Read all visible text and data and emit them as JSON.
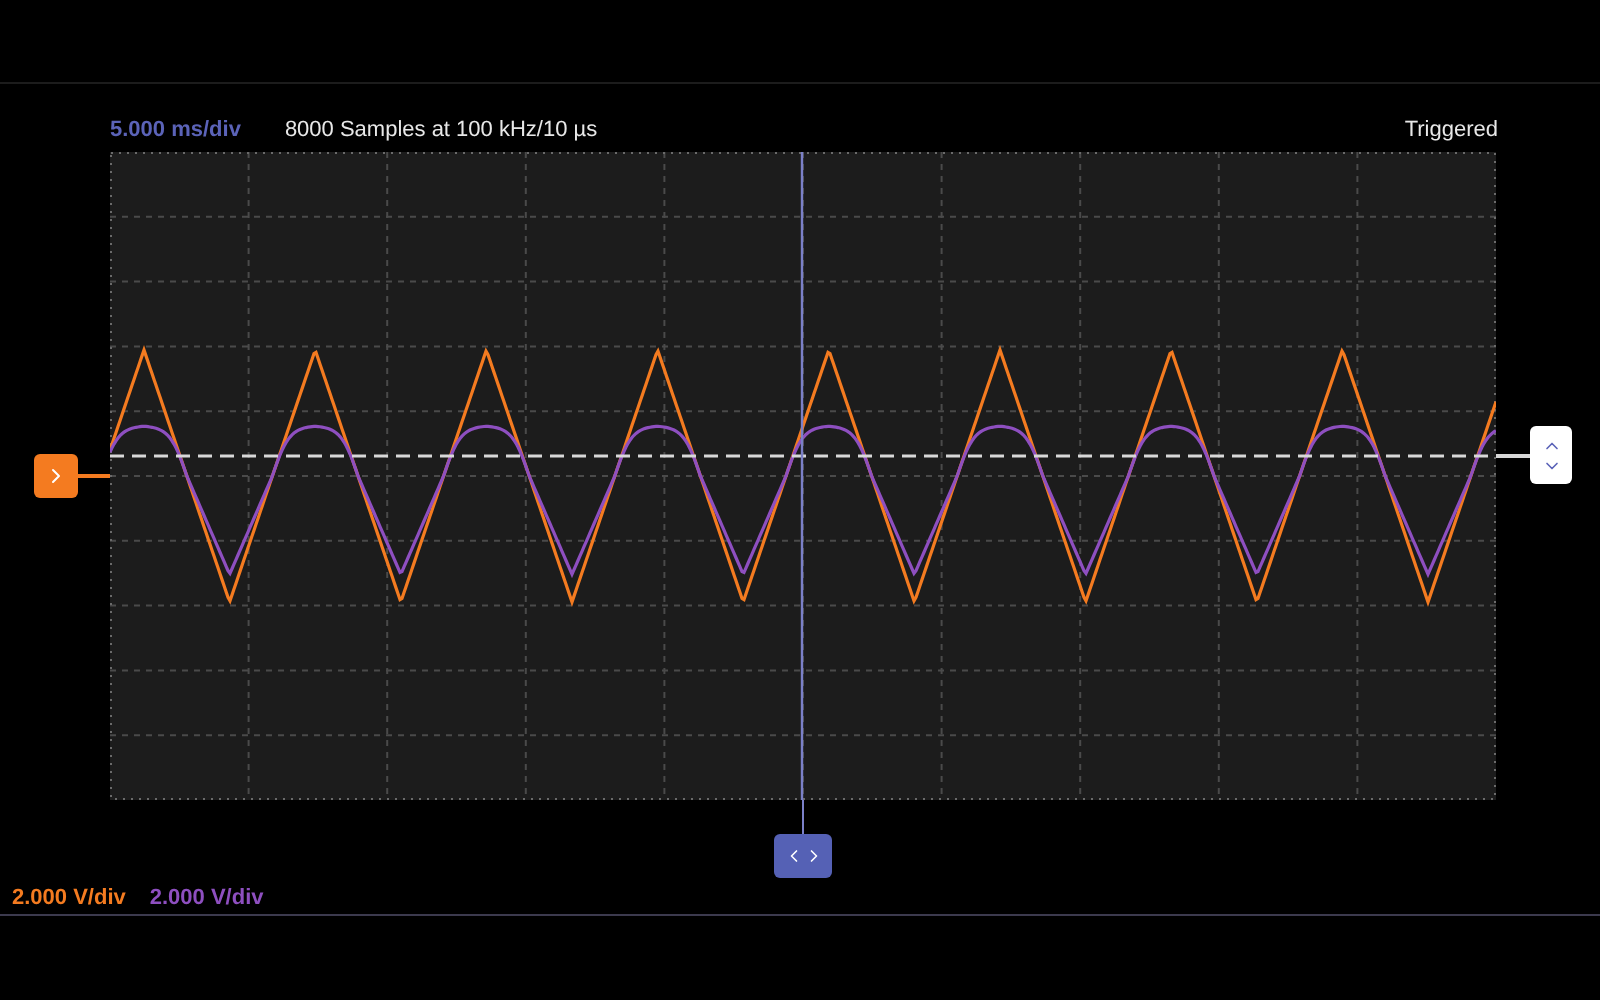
{
  "header": {
    "timebase": "5.000 ms/div",
    "sampling": "8000 Samples at 100 kHz/10 µs",
    "status": "Triggered"
  },
  "channels": [
    {
      "scale": "2.000 V/div",
      "color": "#f47b20"
    },
    {
      "scale": "2.000 V/div",
      "color": "#8e4fc0"
    }
  ]
}
